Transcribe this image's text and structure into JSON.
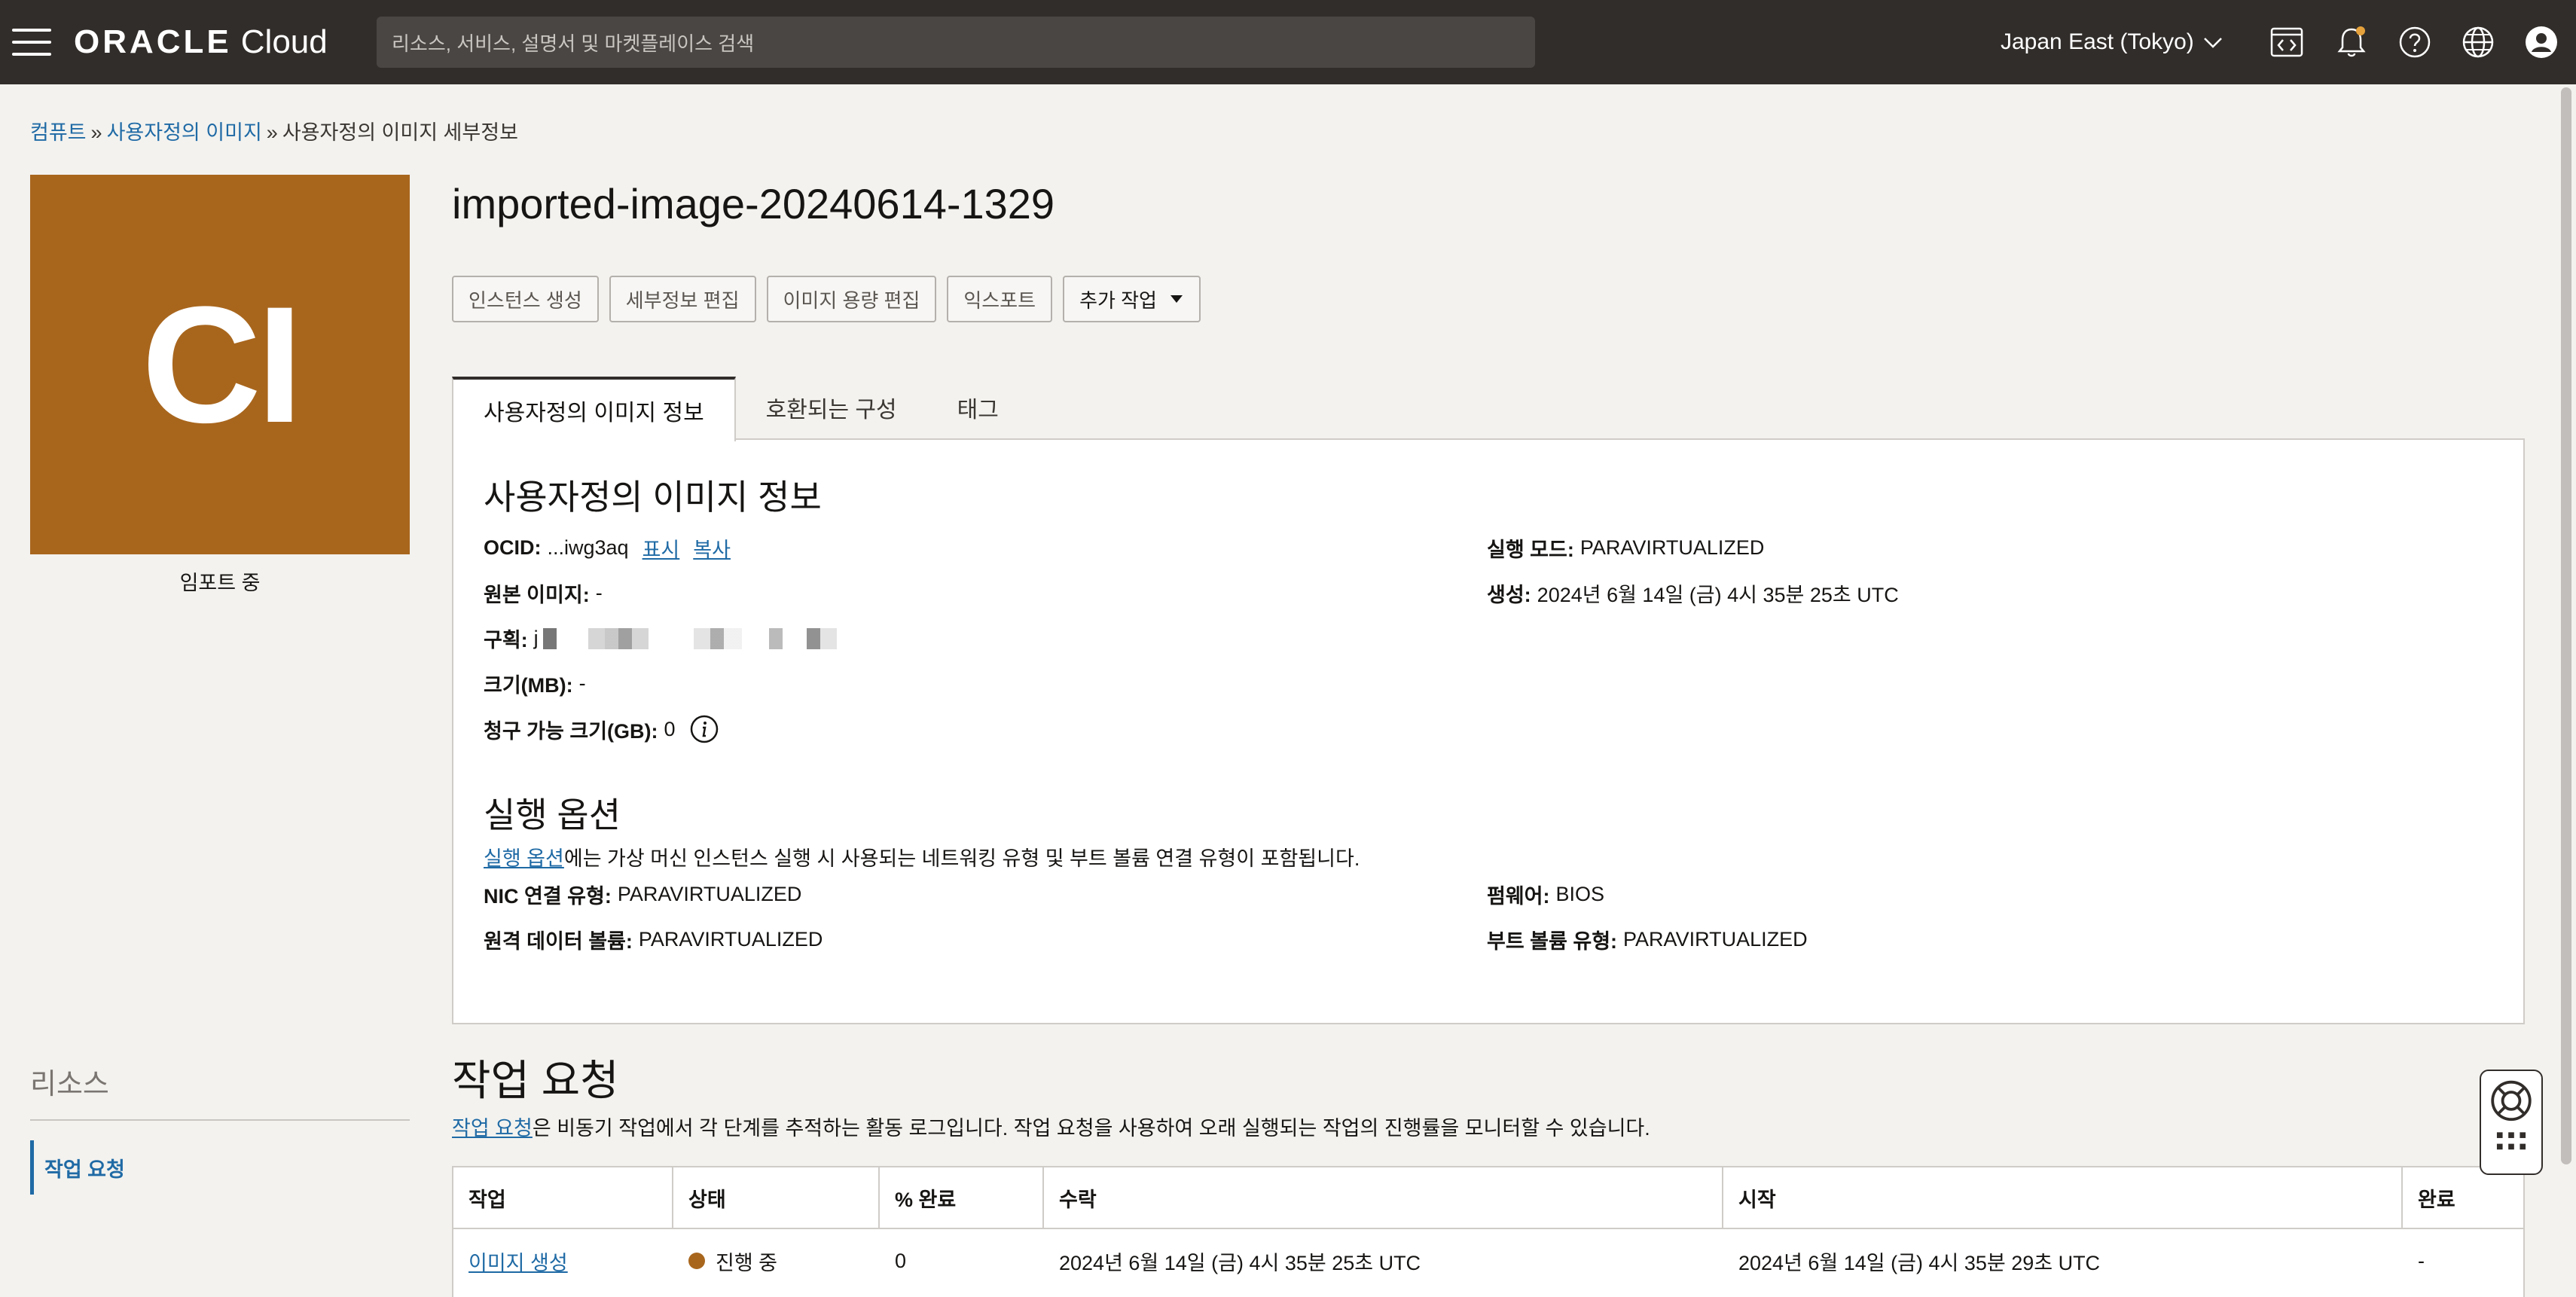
{
  "header": {
    "brand_oracle": "ORACLE",
    "brand_cloud": "Cloud",
    "search_placeholder": "리소스, 서비스, 설명서 및 마켓플레이스 검색",
    "region": "Japan East (Tokyo)"
  },
  "breadcrumb": {
    "items": [
      "컴퓨트",
      "사용자정의 이미지"
    ],
    "current": "사용자정의 이미지 세부정보",
    "separator": "»"
  },
  "avatar": {
    "initials": "CI",
    "color": "#a8661d",
    "status": "임포트 중"
  },
  "resources": {
    "title": "리소스",
    "items": [
      "작업 요청"
    ]
  },
  "page": {
    "title": "imported-image-20240614-1329"
  },
  "actions": {
    "create_instance": "인스턴스 생성",
    "edit_details": "세부정보 편집",
    "edit_capacity": "이미지 용량 편집",
    "export": "익스포트",
    "more_actions": "추가 작업"
  },
  "tabs": [
    "사용자정의 이미지 정보",
    "호환되는 구성",
    "태그"
  ],
  "info": {
    "heading": "사용자정의 이미지 정보",
    "ocid_label": "OCID:",
    "ocid_value": "...iwg3aq",
    "show_link": "표시",
    "copy_link": "복사",
    "source_image_label": "원본 이미지:",
    "source_image_value": "-",
    "compartment_label": "구획:",
    "compartment_value": "j",
    "size_label": "크기(MB):",
    "size_value": "-",
    "billable_label": "청구 가능 크기(GB):",
    "billable_value": "0",
    "launch_mode_label": "실행 모드:",
    "launch_mode_value": "PARAVIRTUALIZED",
    "created_label": "생성:",
    "created_value": "2024년 6월 14일 (금) 4시 35분 25초 UTC"
  },
  "launch_options": {
    "heading": "실행 옵션",
    "desc_link": "실행 옵션",
    "desc_text": "에는 가상 머신 인스턴스 실행 시 사용되는 네트워킹 유형 및 부트 볼륨 연결 유형이 포함됩니다.",
    "nic_label": "NIC 연결 유형:",
    "nic_value": "PARAVIRTUALIZED",
    "remote_label": "원격 데이터 볼륨:",
    "remote_value": "PARAVIRTUALIZED",
    "firmware_label": "펌웨어:",
    "firmware_value": "BIOS",
    "boot_label": "부트 볼륨 유형:",
    "boot_value": "PARAVIRTUALIZED"
  },
  "work_requests": {
    "heading": "작업 요청",
    "desc_link": "작업 요청",
    "desc_text": "은 비동기 작업에서 각 단계를 추적하는 활동 로그입니다. 작업 요청을 사용하여 오래 실행되는 작업의 진행률을 모니터할 수 있습니다.",
    "columns": [
      "작업",
      "상태",
      "% 완료",
      "수락",
      "시작",
      "완료"
    ],
    "rows": [
      {
        "operation": "이미지 생성",
        "status": "진행 중",
        "percent": "0",
        "accepted": "2024년 6월 14일 (금) 4시 35분 25초 UTC",
        "started": "2024년 6월 14일 (금) 4시 35분 29초 UTC",
        "finished": "-"
      }
    ]
  }
}
